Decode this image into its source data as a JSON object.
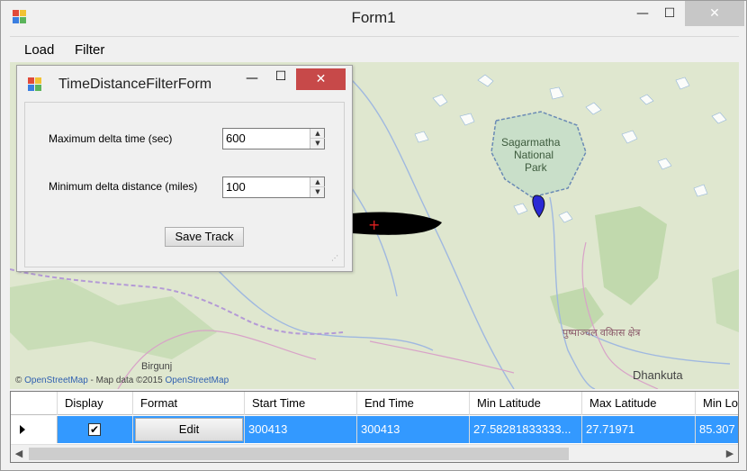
{
  "window": {
    "title": "Form1",
    "minimize_glyph": "—",
    "maximize_glyph": "☐",
    "close_glyph": "✕"
  },
  "menu": {
    "load": "Load",
    "filter": "Filter"
  },
  "map": {
    "attribution_prefix": "© ",
    "attribution_link1": "OpenStreetMap",
    "attribution_mid": " - Map data ©2015 ",
    "attribution_link2": "OpenStreetMap",
    "park_label_1": "Sagarmatha",
    "park_label_2": "National",
    "park_label_3": "Park",
    "town_birgunj": "Birgunj",
    "town_dhankuta": "Dhankuta",
    "devanagari_label": "पुष्पाञ्चल वकिास क्षेत्र",
    "marker_icon": "map-pin-icon"
  },
  "dialog": {
    "title": "TimeDistanceFilterForm",
    "minimize_glyph": "—",
    "maximize_glyph": "☐",
    "close_glyph": "✕",
    "max_delta_time_label": "Maximum delta time (sec)",
    "max_delta_time_value": "600",
    "min_delta_distance_label": "Minimum delta distance (miles)",
    "min_delta_distance_value": "100",
    "save_track_label": "Save Track"
  },
  "grid": {
    "columns": [
      "Display",
      "Format",
      "Start Time",
      "End Time",
      "Min Latitude",
      "Max Latitude",
      "Min Lo"
    ],
    "rows": [
      {
        "display_checked": "✔",
        "format": "Edit",
        "start_time": "300413",
        "end_time": "300413",
        "min_latitude": "27.58281833333...",
        "max_latitude": "27.71971",
        "min_longitude": "85.307"
      }
    ],
    "scroll_left": "◀",
    "scroll_right": "▶"
  },
  "colors": {
    "selection": "#3399ff",
    "close_button": "#c74949",
    "map_land": "#dfe7cf",
    "park_fill": "#c9dfc9"
  }
}
